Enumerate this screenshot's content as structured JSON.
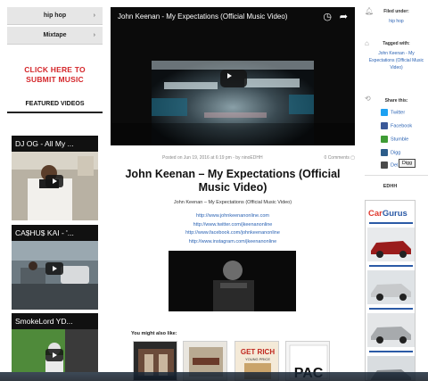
{
  "sidebar_left": {
    "categories": [
      {
        "label": "hip hop"
      },
      {
        "label": "Mixtape"
      }
    ],
    "chevron": "›",
    "submit_line1": "CLICK HERE TO",
    "submit_line2": "SUBMIT MUSIC",
    "featured_title": "FEATURED VIDEOS",
    "videos": [
      {
        "title": "DJ OG - All My ..."
      },
      {
        "title": "CA$HU$ KAI - '..."
      },
      {
        "title": "SmokeLord YD..."
      }
    ]
  },
  "main": {
    "video_title": "John Keenan - My Expectations (Official Music Video)",
    "posted": "Posted on Jun 19, 2016 at 6:19 pm - by ninoEDHH",
    "comments": "0 Comments",
    "title_line1": "John Keenan – My Expectations (Official",
    "title_line2": "Music Video)",
    "subtitle": "John Keenan – My Expectations (Official Music Video)",
    "links": [
      "http://www.johnkeenanonline.com",
      "http://www.twitter.com/jkeenanonline",
      "http://www.facebook.com/johnkeenanonline",
      "http://www.instagram.com/jkeenanonline"
    ],
    "you_might_like": "You might also like:",
    "related": [
      {
        "text": ""
      },
      {
        "text": ""
      },
      {
        "text": "GET RICH\nYOUNG PRICE"
      },
      {
        "text": "PAC"
      }
    ]
  },
  "sidebar_right": {
    "filed_under_label": "Filed under:",
    "filed_under_value": "hip hop",
    "tagged_label": "Tagged with:",
    "tagged_value": "John Keenan - My Expectations (Official Music Video)",
    "share_label": "Share this:",
    "shares": [
      {
        "label": "Twitter",
        "color": "#1da1f2"
      },
      {
        "label": "Facebook",
        "color": "#3b5998"
      },
      {
        "label": "Stumble",
        "color": "#3f9c35"
      },
      {
        "label": "Digg",
        "color": "#2d5d8a"
      },
      {
        "label": "Del.ic",
        "color": "#4a4a4a"
      }
    ],
    "digg_tooltip": "Digg",
    "edhh": "EDHH",
    "ad_logo_a": "Car",
    "ad_logo_b": "Gurus"
  }
}
